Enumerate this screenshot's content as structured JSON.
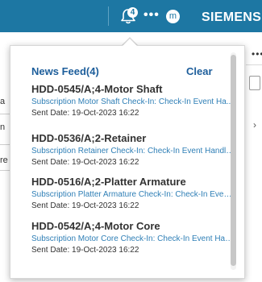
{
  "topbar": {
    "bell_badge": "4",
    "brand": "SIEMENS",
    "avatar_initial": "m",
    "more": "•••",
    "accent": "#1d77a3"
  },
  "background": {
    "left_a": "a",
    "left_n": "n",
    "left_re": "re",
    "right_more": "•••",
    "right_chevron": "›"
  },
  "news_feed": {
    "title": "News Feed(4)",
    "clear_label": "Clear",
    "items": [
      {
        "title": "HDD-0545/A;4-Motor Shaft",
        "subscription": "Subscription Motor Shaft Check-In: Check-In Event Ha...",
        "sent_date": "Sent Date: 19-Oct-2023 16:22"
      },
      {
        "title": "HDD-0536/A;2-Retainer",
        "subscription": "Subscription Retainer Check-In: Check-In Event Handler...",
        "sent_date": "Sent Date: 19-Oct-2023 16:22"
      },
      {
        "title": "HDD-0516/A;2-Platter Armature",
        "subscription": "Subscription Platter Armature Check-In: Check-In Event...",
        "sent_date": "Sent Date: 19-Oct-2023 16:22"
      },
      {
        "title": "HDD-0542/A;4-Motor Core",
        "subscription": "Subscription Motor Core Check-In: Check-In Event Handler...",
        "sent_date": "Sent Date: 19-Oct-2023 16:22"
      }
    ]
  }
}
